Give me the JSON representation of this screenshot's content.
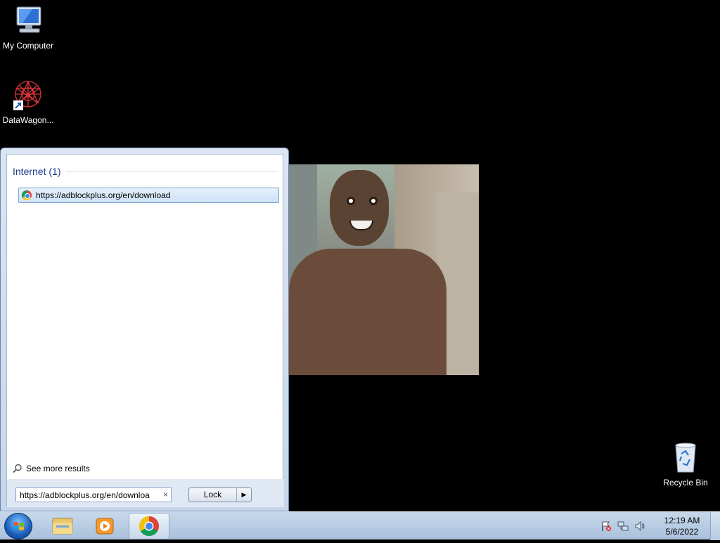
{
  "desktop": {
    "icons": [
      {
        "label": "My Computer"
      },
      {
        "label": "DataWagon..."
      },
      {
        "label": "Recycle Bin"
      }
    ]
  },
  "start_menu": {
    "section_title": "Internet (1)",
    "result_url": "https://adblockplus.org/en/download",
    "see_more": "See more results",
    "search_value": "https://adblockplus.org/en/downloa",
    "search_clear": "×",
    "lock_label": "Lock",
    "lock_arrow": "▶"
  },
  "taskbar": {
    "time": "12:19 AM",
    "date": "5/6/2022"
  },
  "colors": {
    "start_menu_accent": "#1e3d8a",
    "selection_border": "#7da2ce",
    "taskbar": "#b9cde3"
  }
}
